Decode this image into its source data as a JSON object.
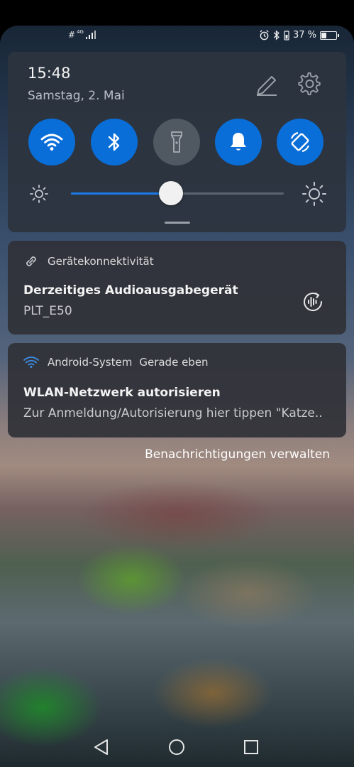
{
  "status_bar": {
    "network_label": "4G",
    "battery_percent_text": "37 %",
    "battery_level": 0.37,
    "icons": [
      "hash-icon",
      "signal-icon",
      "alarm-icon",
      "bluetooth-icon",
      "battery-icon"
    ]
  },
  "quick_settings": {
    "time": "15:48",
    "date": "Samstag, 2. Mai",
    "toggles": [
      {
        "name": "wifi",
        "state": "on"
      },
      {
        "name": "bluetooth",
        "state": "on"
      },
      {
        "name": "flashlight",
        "state": "off"
      },
      {
        "name": "sound",
        "state": "on"
      },
      {
        "name": "auto-rotate",
        "state": "on"
      }
    ],
    "brightness_level": 0.47,
    "accent_color": "#0a6ed8"
  },
  "notifications": [
    {
      "app": "Gerätekonnektivität",
      "title": "Derzeitiges Audioausgabegerät",
      "body": "PLT_E50"
    },
    {
      "app": "Android-System",
      "time": "Gerade eben",
      "title": "WLAN-Netzwerk autorisieren",
      "body": "Zur Anmeldung/Autorisierung hier tippen \"Katze.."
    }
  ],
  "manage_notifications_label": "Benachrichtigungen verwalten",
  "nav_bar": {
    "buttons": [
      "back",
      "home",
      "recents"
    ]
  }
}
